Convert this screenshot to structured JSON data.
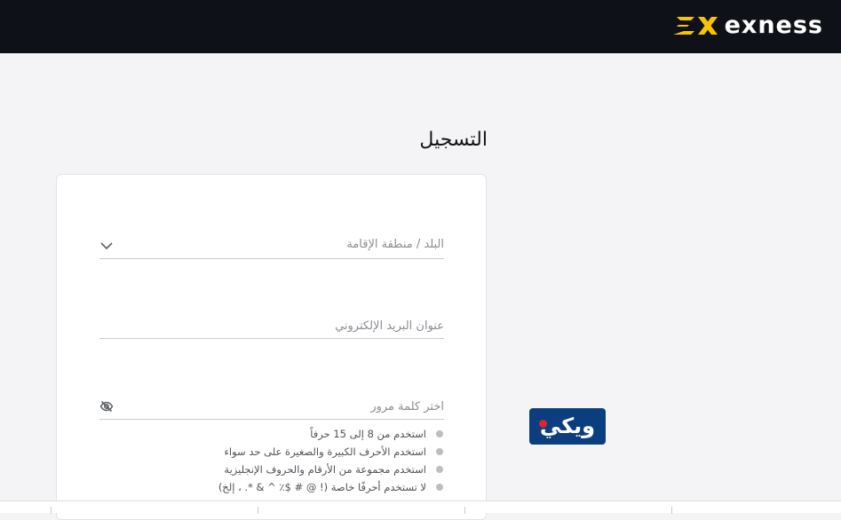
{
  "brand": {
    "name": "exness",
    "mark_color": "#f7c500",
    "mark_icon": "exness-logo-icon"
  },
  "page": {
    "title": "التسجيل"
  },
  "form": {
    "country": {
      "placeholder": "البلد / منطقة الإقامة",
      "icon": "chevron-down-icon"
    },
    "email": {
      "placeholder": "عنوان البريد الإلكتروني"
    },
    "password": {
      "placeholder": "اختر كلمة مرور",
      "icon": "eye-off-icon",
      "rules": [
        "استخدم من 8 إلى 15 حرفاً",
        "استخدم الأحرف الكبيرة والصغيرة على حد سواء",
        "استخدم مجموعة من الأرقام والحروف الإنجليزية",
        "لا تستخدم أحرفًا خاصة (! @ # $٪ ^ & *. ، إلخ)"
      ]
    }
  },
  "watermark": {
    "text": "ويكي",
    "color": "#0b3e7e"
  }
}
